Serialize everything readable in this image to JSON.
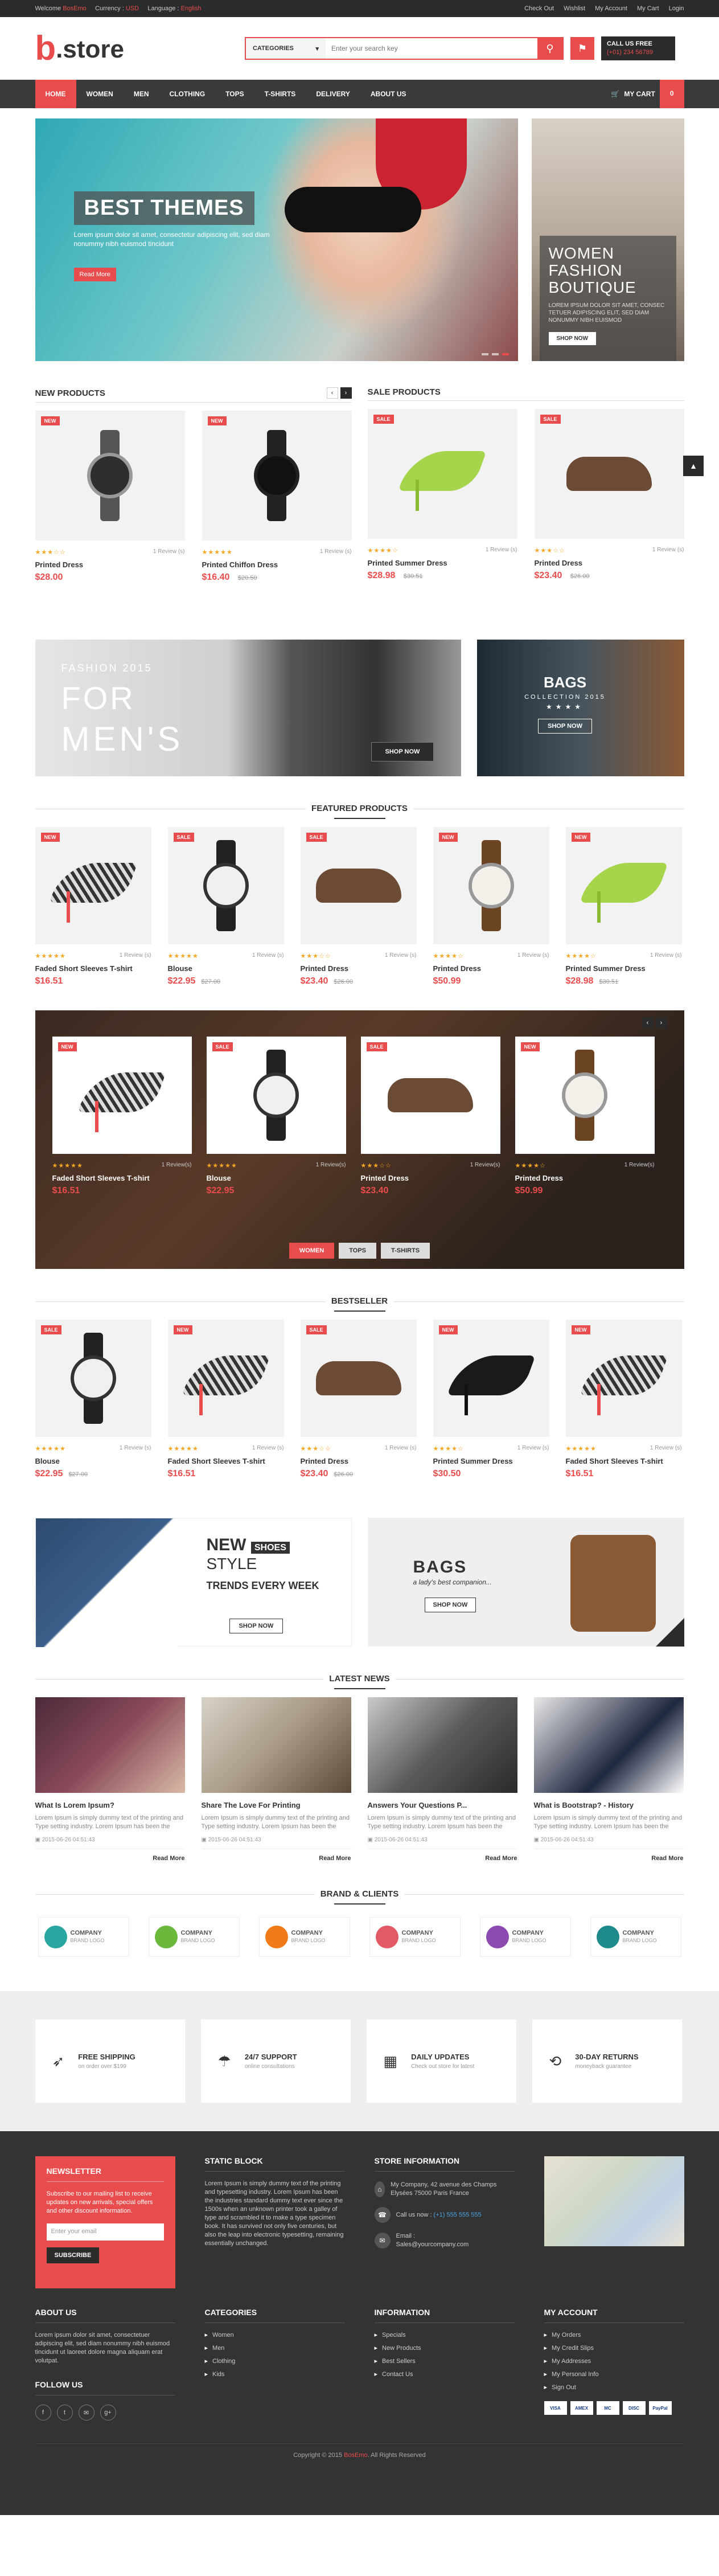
{
  "topbar": {
    "welcome": "Welcome",
    "welcome_brand": "BosEmo",
    "currency_label": "Currency :",
    "currency_value": "USD",
    "language_label": "Language :",
    "language_value": "English",
    "links": [
      "Check Out",
      "Wishlist",
      "My Account",
      "My Cart",
      "Login"
    ]
  },
  "header": {
    "logo_letter": "b",
    "logo_text": ".store",
    "search_category": "CATEGORIES",
    "search_placeholder": "Enter your search key",
    "call_label": "CALL US FREE",
    "call_phone": "(+01) 234 56789"
  },
  "nav": {
    "items": [
      "HOME",
      "WOMEN",
      "MEN",
      "CLOTHING",
      "TOPS",
      "T-SHIRTS",
      "DELIVERY",
      "ABOUT US"
    ],
    "cart_label": "MY CART",
    "cart_count": "0"
  },
  "hero": {
    "title": "BEST THEMES",
    "text": "Lorem ipsum dolor sit amet, consectetur adipiscing elit, sed diam nonummy nibh euismod tincidunt",
    "more": "Read More",
    "side_title": "WOMEN FASHION BOUTIQUE",
    "side_text": "LOREM IPSUM DOLOR SIT AMET, CONSEC TETUER ADIPISCING ELIT, SED DIAM NONUMMY NIBH EUISMOD",
    "side_button": "SHOP NOW"
  },
  "new_products": {
    "title": "NEW PRODUCTS",
    "items": [
      {
        "badge": "NEW",
        "name": "Printed Dress",
        "price": "$28.00",
        "old": "",
        "reviews": "1 Review (s)",
        "stars": "★★★☆☆"
      },
      {
        "badge": "NEW",
        "name": "Printed Chiffon Dress",
        "price": "$16.40",
        "old": "$20.50",
        "reviews": "1 Review (s)",
        "stars": "★★★★★"
      }
    ]
  },
  "sale_products": {
    "title": "SALE PRODUCTS",
    "items": [
      {
        "badge": "SALE",
        "name": "Printed Summer Dress",
        "price": "$28.98",
        "old": "$30.51",
        "reviews": "1 Review (s)",
        "stars": "★★★★☆"
      },
      {
        "badge": "SALE",
        "name": "Printed Dress",
        "price": "$23.40",
        "old": "$26.00",
        "reviews": "1 Review (s)",
        "stars": "★★★☆☆"
      }
    ]
  },
  "banner_men": {
    "line1": "FASHION 2015",
    "line2": "FOR",
    "line3": "MEN'S",
    "button": "SHOP NOW"
  },
  "banner_bags": {
    "title": "BAGS",
    "sub": "COLLECTION 2015",
    "stars": "★★★★",
    "button": "SHOP NOW"
  },
  "featured": {
    "title": "FEATURED PRODUCTS",
    "items": [
      {
        "badge": "NEW",
        "name": "Faded Short Sleeves T-shirt",
        "price": "$16.51",
        "old": "",
        "reviews": "1 Review (s)",
        "stars": "★★★★★"
      },
      {
        "badge": "SALE",
        "name": "Blouse",
        "price": "$22.95",
        "old": "$27.00",
        "reviews": "1 Review (s)",
        "stars": "★★★★★"
      },
      {
        "badge": "SALE",
        "name": "Printed Dress",
        "price": "$23.40",
        "old": "$26.00",
        "reviews": "1 Review (s)",
        "stars": "★★★☆☆"
      },
      {
        "badge": "NEW",
        "name": "Printed Dress",
        "price": "$50.99",
        "old": "",
        "reviews": "1 Review (s)",
        "stars": "★★★★☆"
      },
      {
        "badge": "NEW",
        "name": "Printed Summer Dress",
        "price": "$28.98",
        "old": "$30.51",
        "reviews": "1 Review (s)",
        "stars": "★★★★☆"
      }
    ]
  },
  "tabbed": {
    "items": [
      {
        "badge": "NEW",
        "name": "Faded Short Sleeves T-shirt",
        "price": "$16.51",
        "reviews": "1 Review(s)",
        "stars": "★★★★★"
      },
      {
        "badge": "SALE",
        "name": "Blouse",
        "price": "$22.95",
        "reviews": "1 Review(s)",
        "stars": "★★★★★"
      },
      {
        "badge": "SALE",
        "name": "Printed Dress",
        "price": "$23.40",
        "reviews": "1 Review(s)",
        "stars": "★★★☆☆"
      },
      {
        "badge": "NEW",
        "name": "Printed Dress",
        "price": "$50.99",
        "reviews": "1 Review(s)",
        "stars": "★★★★☆"
      }
    ],
    "tabs": [
      "WOMEN",
      "TOPS",
      "T-SHIRTS"
    ]
  },
  "bestseller": {
    "title": "BESTSELLER",
    "items": [
      {
        "badge": "SALE",
        "name": "Blouse",
        "price": "$22.95",
        "old": "$27.00",
        "reviews": "1 Review (s)",
        "stars": "★★★★★"
      },
      {
        "badge": "NEW",
        "name": "Faded Short Sleeves T-shirt",
        "price": "$16.51",
        "old": "",
        "reviews": "1 Review (s)",
        "stars": "★★★★★"
      },
      {
        "badge": "SALE",
        "name": "Printed Dress",
        "price": "$23.40",
        "old": "$26.00",
        "reviews": "1 Review (s)",
        "stars": "★★★☆☆"
      },
      {
        "badge": "NEW",
        "name": "Printed Summer Dress",
        "price": "$30.50",
        "old": "",
        "reviews": "1 Review (s)",
        "stars": "★★★★☆"
      },
      {
        "badge": "NEW",
        "name": "Faded Short Sleeves T-shirt",
        "price": "$16.51",
        "old": "",
        "reviews": "1 Review (s)",
        "stars": "★★★★★"
      }
    ]
  },
  "banner_shoes": {
    "new": "NEW",
    "shoes": "SHOES",
    "style": "STYLE",
    "trends": "TRENDS EVERY WEEK",
    "button": "SHOP NOW"
  },
  "banner_bags2": {
    "title": "BAGS",
    "sub": "a lady's best companion...",
    "button": "SHOP NOW"
  },
  "news": {
    "title": "LATEST NEWS",
    "items": [
      {
        "title": "What Is Lorem Ipsum?",
        "text": "Lorem Ipsum is simply dummy text of the printing and Type setting industry. Lorem Ipsum has been the",
        "date": "2015-06-26 04:51:43",
        "more": "Read More"
      },
      {
        "title": "Share The Love For Printing",
        "text": "Lorem Ipsum is simply dummy text of the printing and Type setting industry. Lorem Ipsum has been the",
        "date": "2015-06-26 04:51:43",
        "more": "Read More"
      },
      {
        "title": "Answers Your Questions P...",
        "text": "Lorem Ipsum is simply dummy text of the printing and Type setting industry. Lorem Ipsum has been the",
        "date": "2015-06-26 04:51:43",
        "more": "Read More"
      },
      {
        "title": "What is Bootstrap? - History",
        "text": "Lorem Ipsum is simply dummy text of the printing and Type setting industry. Lorem Ipsum has been the",
        "date": "2015-06-26 04:51:43",
        "more": "Read More"
      }
    ]
  },
  "brands": {
    "title": "BRAND & CLIENTS",
    "items": [
      {
        "name": "COMPANY",
        "sub": "BRAND LOGO",
        "color": "#2aa6a0"
      },
      {
        "name": "COMPANY",
        "sub": "BRAND LOGO",
        "color": "#6ab83c"
      },
      {
        "name": "COMPANY",
        "sub": "BRAND LOGO",
        "color": "#f07b18"
      },
      {
        "name": "COMPANY",
        "sub": "BRAND LOGO",
        "color": "#e25a66"
      },
      {
        "name": "COMPANY",
        "sub": "BRAND LOGO",
        "color": "#8a4ab0"
      },
      {
        "name": "COMPANY",
        "sub": "BRAND LOGO",
        "color": "#1f8a8a"
      }
    ]
  },
  "features": [
    {
      "title": "FREE SHIPPING",
      "sub": "on order over $199"
    },
    {
      "title": "24/7 SUPPORT",
      "sub": "online consultations"
    },
    {
      "title": "DAILY UPDATES",
      "sub": "Check out store for latest"
    },
    {
      "title": "30-DAY RETURNS",
      "sub": "moneyback guarantee"
    }
  ],
  "footer": {
    "newsletter_title": "NEWSLETTER",
    "newsletter_text": "Subscribe to our mailing list to receive updates on new arrivals, special offers and other discount information.",
    "newsletter_placeholder": "Enter your email",
    "newsletter_button": "SUBSCRIBE",
    "static_title": "STATIC BLOCK",
    "static_text": "Lorem Ipsum is simply dummy text of the printing and typesetting industry. Lorem Ipsum has been the industries standard dummy text ever since the 1500s when an unknown printer took a galley of type and scrambled it to make a type specimen book. It has survived not only five centuries, but also the leap into electronic typesetting, remaining essentially unchanged.",
    "store_title": "STORE INFORMATION",
    "store_address": "My Company, 42 avenue des Champs Elysées 75000 Paris France",
    "store_call": "Call us now :",
    "store_phone": "(+1) 555 555 555",
    "store_email_label": "Email :",
    "store_email": "Sales@yourcompany.com",
    "about_title": "ABOUT US",
    "about_text": "Lorem ipsum dolor sit amet, consectetuer adipiscing elit, sed diam nonummy nibh euismod tincidunt ut laoreet dolore magna aliquam erat volutpat.",
    "follow_title": "FOLLOW US",
    "social": [
      "f",
      "t",
      "✉",
      "g+"
    ],
    "categories_title": "CATEGORIES",
    "categories": [
      "Women",
      "Men",
      "Clothing",
      "Kids"
    ],
    "information_title": "INFORMATION",
    "information": [
      "Specials",
      "New Products",
      "Best Sellers",
      "Contact Us"
    ],
    "account_title": "MY ACCOUNT",
    "account": [
      "My Orders",
      "My Credit Slips",
      "My Addresses",
      "My Personal Info",
      "Sign Out"
    ],
    "payments": [
      "VISA",
      "AMEX",
      "MC",
      "DISC",
      "PayPal"
    ],
    "copyright": "Copyright © 2015",
    "copyright_brand": "BosEmo",
    "copyright_tail": ". All Rights Reserved"
  }
}
